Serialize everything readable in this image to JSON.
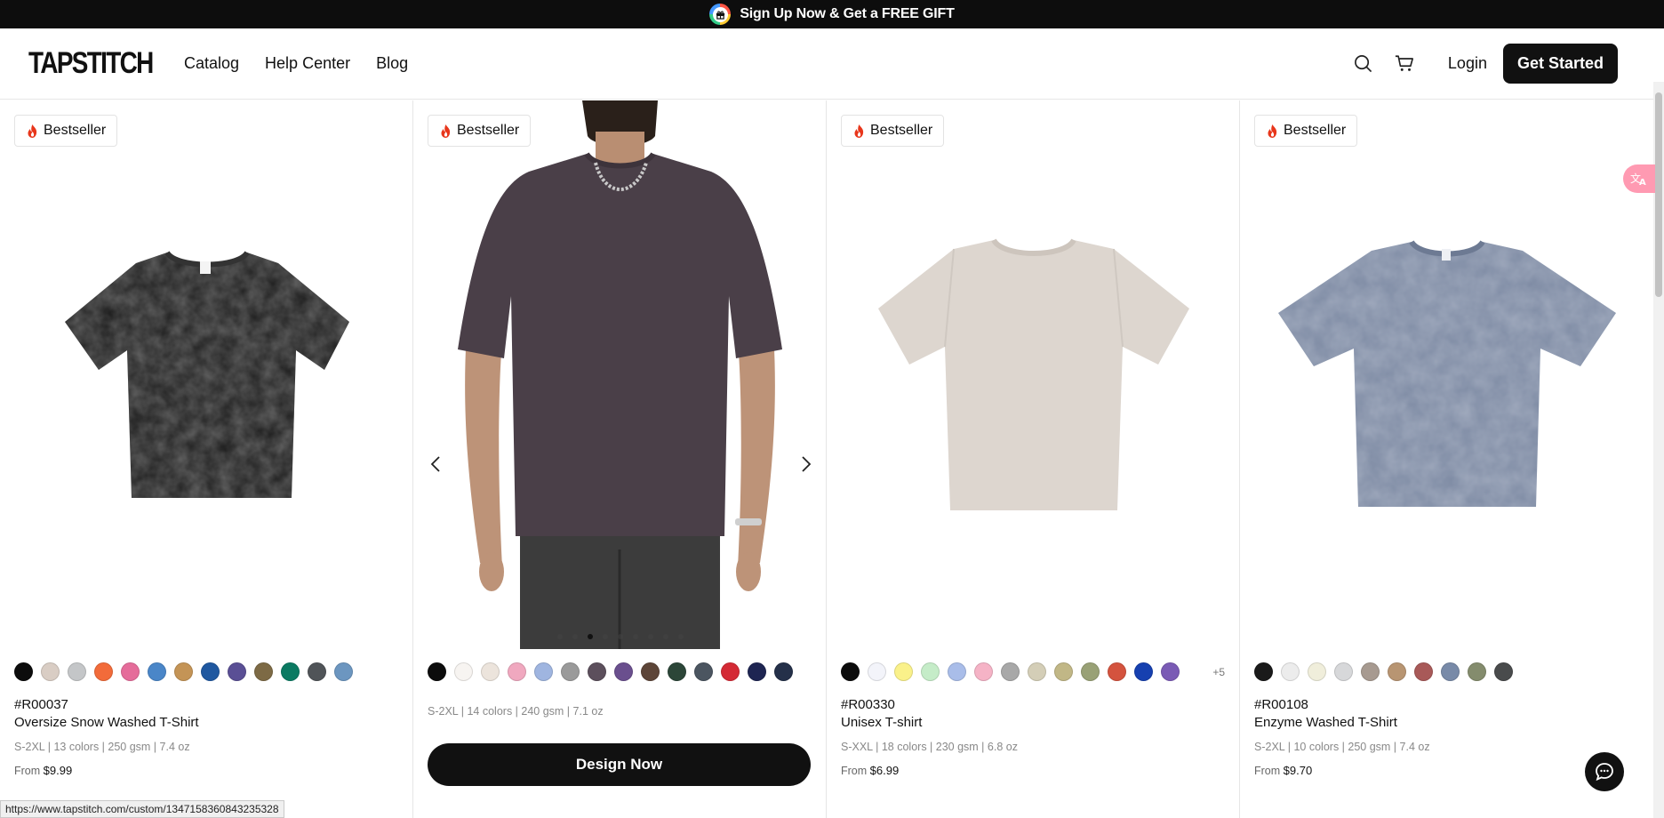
{
  "promo": {
    "text": "Sign Up Now & Get a FREE GIFT"
  },
  "nav": {
    "logo": "TAPSTITCH",
    "links": [
      "Catalog",
      "Help Center",
      "Blog"
    ],
    "login": "Login",
    "cta": "Get Started"
  },
  "products": [
    {
      "badge": "Bestseller",
      "sku": "#R00037",
      "name": "Oversize Snow Washed T-Shirt",
      "specs": "S-2XL | 13 colors | 250 gsm | 7.4 oz",
      "price_prefix": "From",
      "price": "$9.99",
      "swatches": [
        "#0c0c0c",
        "#d9cdc4",
        "#c4c6c8",
        "#f26b3a",
        "#e56c9a",
        "#4a86c8",
        "#c49456",
        "#1f58a0",
        "#5a4f95",
        "#7d6a45",
        "#0b7a62",
        "#505458",
        "#6c96c0"
      ]
    },
    {
      "badge": "Bestseller",
      "specs": "S-2XL | 14 colors | 240 gsm | 7.1 oz",
      "button": "Design Now",
      "swatches": [
        "#0c0c0c",
        "#f7f4f1",
        "#ece4dc",
        "#f0a8bf",
        "#9fb5e0",
        "#9a9a9a",
        "#5c4f5c",
        "#6a4f8e",
        "#5d4538",
        "#2c4638",
        "#4b5560",
        "#d42a35",
        "#1e2552",
        "#243049"
      ]
    },
    {
      "badge": "Bestseller",
      "sku": "#R00330",
      "name": "Unisex T-shirt",
      "specs": "S-XXL | 18 colors | 230 gsm | 6.8 oz",
      "price_prefix": "From",
      "price": "$6.99",
      "more": "+5",
      "swatches": [
        "#0c0c0c",
        "#f3f4fa",
        "#faf18a",
        "#c5ecc8",
        "#a9bde9",
        "#f5b3c6",
        "#a8a8a8",
        "#d4ceb7",
        "#c1b786",
        "#99a176",
        "#d4533e",
        "#1640b0",
        "#7a5bb5"
      ]
    },
    {
      "badge": "Bestseller",
      "sku": "#R00108",
      "name": "Enzyme Washed T-Shirt",
      "specs": "S-2XL | 10 colors | 250 gsm | 7.4 oz",
      "price_prefix": "From",
      "price": "$9.70",
      "swatches": [
        "#1a1a1a",
        "#ececec",
        "#f0eedb",
        "#d7d8da",
        "#a79a90",
        "#b89572",
        "#a85958",
        "#788aa8",
        "#848c6d",
        "#494b4c"
      ]
    }
  ],
  "status_url": "https://www.tapstitch.com/custom/1347158360843235328"
}
